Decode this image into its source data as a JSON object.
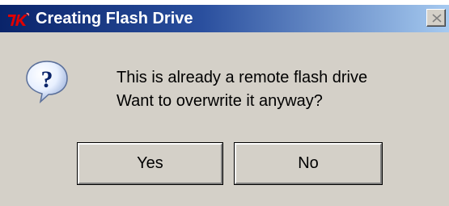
{
  "window": {
    "title": "Creating Flash Drive",
    "app_icon": "tk-feather-icon",
    "close_icon": "close-icon"
  },
  "dialog": {
    "icon": "question-icon",
    "message_line1": "This is already a remote flash drive",
    "message_line2": "Want to overwrite it anyway?"
  },
  "buttons": {
    "yes_label": "Yes",
    "no_label": "No"
  },
  "colors": {
    "titlebar_start": "#0a246a",
    "titlebar_end": "#a6caf0",
    "dialog_bg": "#d4d0c8",
    "question_icon": "#0a246a"
  }
}
